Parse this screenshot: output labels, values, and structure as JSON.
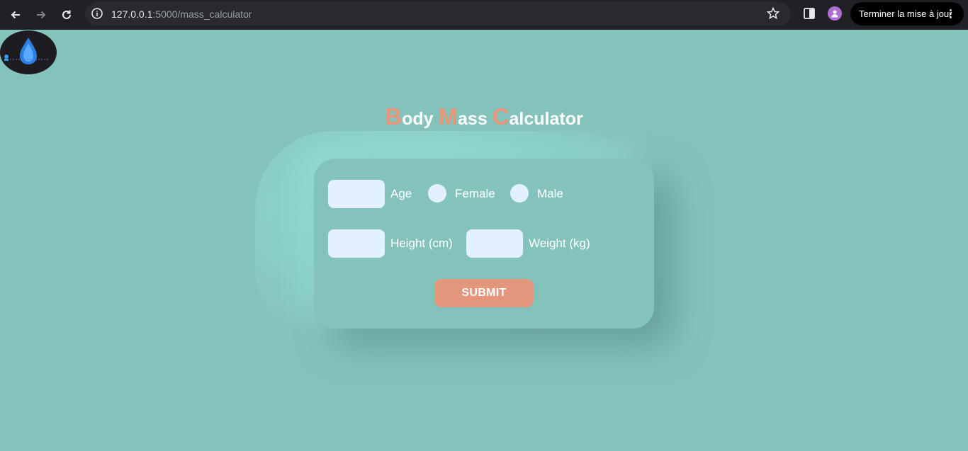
{
  "browser": {
    "url_host": "127.0.0.1",
    "url_path": ":5000/mass_calculator",
    "update_label": "Terminer la mise à jour",
    "menu_glyph": "⋮"
  },
  "page": {
    "title_parts": [
      {
        "cap": "B",
        "rest": "ody "
      },
      {
        "cap": "M",
        "rest": "ass "
      },
      {
        "cap": "C",
        "rest": "alculator"
      }
    ]
  },
  "form": {
    "age_label": "Age",
    "female_label": "Female",
    "male_label": "Male",
    "height_label": "Height (cm)",
    "weight_label": "Weight (kg)",
    "submit_label": "SUBMIT",
    "age_value": "",
    "height_value": "",
    "weight_value": ""
  },
  "colors": {
    "background": "#84c3bc",
    "accent": "#e8957a",
    "input": "#e2f0ff"
  }
}
